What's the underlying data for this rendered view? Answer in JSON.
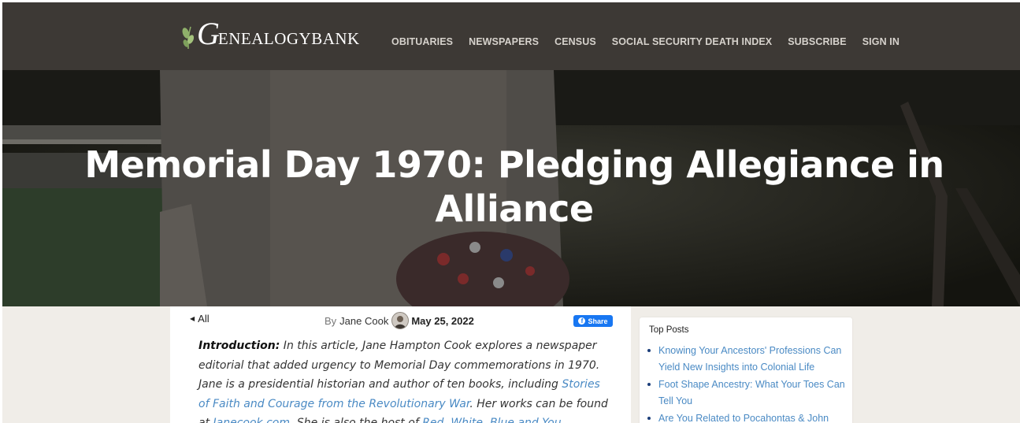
{
  "brand": {
    "logo_initial": "G",
    "logo_text": "ENEALOGYBANK",
    "colors": {
      "header_bg": "#3d3935",
      "link": "#4a8ac4",
      "share_bg": "#1877f2"
    }
  },
  "nav": {
    "items": [
      {
        "label": "OBITUARIES"
      },
      {
        "label": "NEWSPAPERS"
      },
      {
        "label": "CENSUS"
      },
      {
        "label": "SOCIAL SECURITY DEATH INDEX"
      },
      {
        "label": "SUBSCRIBE"
      },
      {
        "label": "SIGN IN"
      }
    ]
  },
  "hero": {
    "title": "Memorial Day 1970: Pledging Allegiance in Alliance"
  },
  "article": {
    "back_label": "All",
    "back_icon": "left-triangle-icon",
    "by_label": "By",
    "author": "Jane Cook",
    "date": "May 25, 2022",
    "share_label": "Share",
    "intro_label": "Introduction:",
    "body_part1": " In this article, Jane Hampton Cook explores a newspaper editorial that added urgency to Memorial Day commemorations in 1970. Jane is a presidential historian and author of ten books, including ",
    "link1": "Stories of Faith and Courage from the Revolutionary War",
    "body_part2": ". Her works can be found at ",
    "link2": "Janecook.com",
    "body_part3": ". She is also the host of ",
    "link3": "Red, White, Blue and You"
  },
  "top_posts": {
    "heading": "Top Posts",
    "items": [
      {
        "label": "Knowing Your Ancestors' Professions Can Yield New Insights into Colonial Life"
      },
      {
        "label": "Foot Shape Ancestry: What Your Toes Can Tell You"
      },
      {
        "label": "Are You Related to Pocahontas & John"
      }
    ]
  }
}
